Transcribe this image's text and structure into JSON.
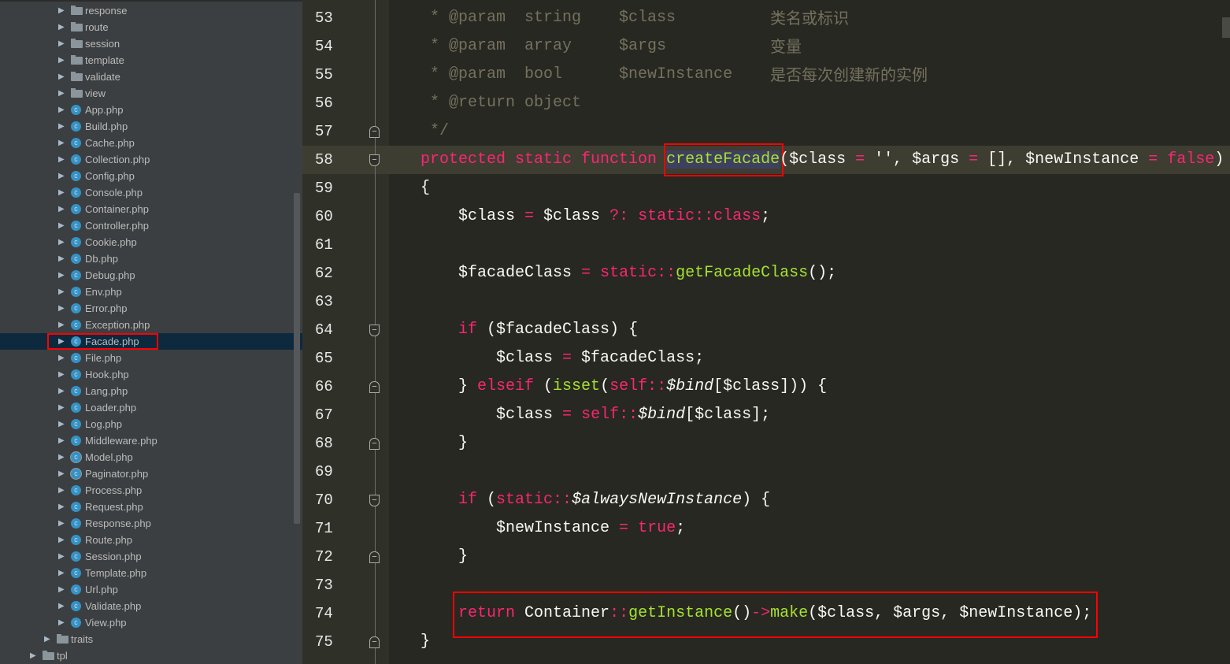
{
  "sidebar": {
    "items": [
      {
        "label": "response",
        "type": "folder",
        "depth": 2
      },
      {
        "label": "route",
        "type": "folder",
        "depth": 2
      },
      {
        "label": "session",
        "type": "folder",
        "depth": 2
      },
      {
        "label": "template",
        "type": "folder",
        "depth": 2
      },
      {
        "label": "validate",
        "type": "folder",
        "depth": 2
      },
      {
        "label": "view",
        "type": "folder",
        "depth": 2
      },
      {
        "label": "App.php",
        "type": "class",
        "depth": 2
      },
      {
        "label": "Build.php",
        "type": "class",
        "depth": 2
      },
      {
        "label": "Cache.php",
        "type": "class",
        "depth": 2
      },
      {
        "label": "Collection.php",
        "type": "class",
        "depth": 2
      },
      {
        "label": "Config.php",
        "type": "class",
        "depth": 2
      },
      {
        "label": "Console.php",
        "type": "class",
        "depth": 2
      },
      {
        "label": "Container.php",
        "type": "class",
        "depth": 2
      },
      {
        "label": "Controller.php",
        "type": "class",
        "depth": 2
      },
      {
        "label": "Cookie.php",
        "type": "class",
        "depth": 2
      },
      {
        "label": "Db.php",
        "type": "class",
        "depth": 2
      },
      {
        "label": "Debug.php",
        "type": "class",
        "depth": 2
      },
      {
        "label": "Env.php",
        "type": "class",
        "depth": 2
      },
      {
        "label": "Error.php",
        "type": "class",
        "depth": 2
      },
      {
        "label": "Exception.php",
        "type": "class",
        "depth": 2
      },
      {
        "label": "Facade.php",
        "type": "class",
        "depth": 2,
        "selected": true
      },
      {
        "label": "File.php",
        "type": "class",
        "depth": 2
      },
      {
        "label": "Hook.php",
        "type": "class",
        "depth": 2
      },
      {
        "label": "Lang.php",
        "type": "class",
        "depth": 2
      },
      {
        "label": "Loader.php",
        "type": "class",
        "depth": 2
      },
      {
        "label": "Log.php",
        "type": "class",
        "depth": 2
      },
      {
        "label": "Middleware.php",
        "type": "class",
        "depth": 2
      },
      {
        "label": "Model.php",
        "type": "abstract",
        "depth": 2
      },
      {
        "label": "Paginator.php",
        "type": "abstract",
        "depth": 2
      },
      {
        "label": "Process.php",
        "type": "class",
        "depth": 2
      },
      {
        "label": "Request.php",
        "type": "class",
        "depth": 2
      },
      {
        "label": "Response.php",
        "type": "class",
        "depth": 2
      },
      {
        "label": "Route.php",
        "type": "class",
        "depth": 2
      },
      {
        "label": "Session.php",
        "type": "class",
        "depth": 2
      },
      {
        "label": "Template.php",
        "type": "class",
        "depth": 2
      },
      {
        "label": "Url.php",
        "type": "class",
        "depth": 2
      },
      {
        "label": "Validate.php",
        "type": "class",
        "depth": 2
      },
      {
        "label": "View.php",
        "type": "class",
        "depth": 2
      },
      {
        "label": "traits",
        "type": "folder",
        "depth": 1
      },
      {
        "label": "tpl",
        "type": "folder",
        "depth": 0
      }
    ]
  },
  "editor": {
    "current_line": 58,
    "fold_lines": [
      57,
      58,
      64,
      66,
      68,
      70,
      72,
      75
    ],
    "lines": [
      {
        "n": "53",
        "t": [
          [
            "cm",
            " * @param  string    $class"
          ]
        ],
        "note": "类名或标识"
      },
      {
        "n": "54",
        "t": [
          [
            "cm",
            " * @param  array     $args"
          ]
        ],
        "note": "变量"
      },
      {
        "n": "55",
        "t": [
          [
            "cm",
            " * @param  bool      $newInstance"
          ]
        ],
        "note": "是否每次创建新的实例"
      },
      {
        "n": "56",
        "t": [
          [
            "cm",
            " * @return object"
          ]
        ]
      },
      {
        "n": "57",
        "t": [
          [
            "cm",
            " */"
          ]
        ]
      },
      {
        "n": "58",
        "t": [
          [
            "kw",
            "protected static function "
          ],
          [
            "fn hl",
            "createFacade"
          ],
          [
            "",
            "($class "
          ],
          [
            "kw",
            "="
          ],
          [
            "",
            " '', $args "
          ],
          [
            "kw",
            "="
          ],
          [
            "",
            " [], $newInstance "
          ],
          [
            "kw",
            "="
          ],
          [
            "",
            " "
          ],
          [
            "kw",
            "false"
          ],
          [
            "",
            ")"
          ]
        ]
      },
      {
        "n": "59",
        "t": [
          [
            "",
            "{"
          ]
        ]
      },
      {
        "n": "60",
        "t": [
          [
            "",
            "    $class "
          ],
          [
            "kw",
            "="
          ],
          [
            "",
            " $class "
          ],
          [
            "kw",
            "?: static::class"
          ],
          [
            "",
            ";"
          ]
        ]
      },
      {
        "n": "61",
        "t": []
      },
      {
        "n": "62",
        "t": [
          [
            "",
            "    $facadeClass "
          ],
          [
            "kw",
            "="
          ],
          [
            "",
            " "
          ],
          [
            "kw",
            "static::"
          ],
          [
            "fn",
            "getFacadeClass"
          ],
          [
            "",
            "();"
          ]
        ]
      },
      {
        "n": "63",
        "t": []
      },
      {
        "n": "64",
        "t": [
          [
            "",
            "    "
          ],
          [
            "kw",
            "if"
          ],
          [
            "",
            " ($facadeClass) {"
          ]
        ]
      },
      {
        "n": "65",
        "t": [
          [
            "",
            "        $class "
          ],
          [
            "kw",
            "="
          ],
          [
            "",
            " $facadeClass;"
          ]
        ]
      },
      {
        "n": "66",
        "t": [
          [
            "",
            "    } "
          ],
          [
            "kw",
            "elseif"
          ],
          [
            "",
            " ("
          ],
          [
            "fn",
            "isset"
          ],
          [
            "",
            "("
          ],
          [
            "kw",
            "self::"
          ],
          [
            "it",
            "$bind"
          ],
          [
            "",
            "[$class])) {"
          ]
        ]
      },
      {
        "n": "67",
        "t": [
          [
            "",
            "        $class "
          ],
          [
            "kw",
            "="
          ],
          [
            "",
            " "
          ],
          [
            "kw",
            "self::"
          ],
          [
            "it",
            "$bind"
          ],
          [
            "",
            "[$class];"
          ]
        ]
      },
      {
        "n": "68",
        "t": [
          [
            "",
            "    }"
          ]
        ]
      },
      {
        "n": "69",
        "t": []
      },
      {
        "n": "70",
        "t": [
          [
            "",
            "    "
          ],
          [
            "kw",
            "if"
          ],
          [
            "",
            " ("
          ],
          [
            "kw",
            "static::"
          ],
          [
            "it",
            "$alwaysNewInstance"
          ],
          [
            "",
            ") {"
          ]
        ]
      },
      {
        "n": "71",
        "t": [
          [
            "",
            "        $newInstance "
          ],
          [
            "kw",
            "="
          ],
          [
            "",
            " "
          ],
          [
            "kw",
            "true"
          ],
          [
            "",
            ";"
          ]
        ]
      },
      {
        "n": "72",
        "t": [
          [
            "",
            "    }"
          ]
        ]
      },
      {
        "n": "73",
        "t": []
      },
      {
        "n": "74",
        "t": [
          [
            "",
            "    "
          ],
          [
            "kw",
            "return"
          ],
          [
            "",
            " Container"
          ],
          [
            "kw",
            "::"
          ],
          [
            "fn",
            "getInstance"
          ],
          [
            "",
            "()"
          ],
          [
            "kw",
            "->"
          ],
          [
            "fn",
            "make"
          ],
          [
            "",
            "($class, $args, $newInstance);"
          ]
        ]
      },
      {
        "n": "75",
        "t": [
          [
            "",
            "}"
          ]
        ]
      }
    ]
  },
  "colors": {
    "keyword": "#f92672",
    "function": "#a6e22e",
    "comment": "#75715e",
    "text": "#f8f8f2",
    "highlight_box": "#ff0000",
    "sidebar_bg": "#3c3f41",
    "editor_bg": "#272822"
  }
}
